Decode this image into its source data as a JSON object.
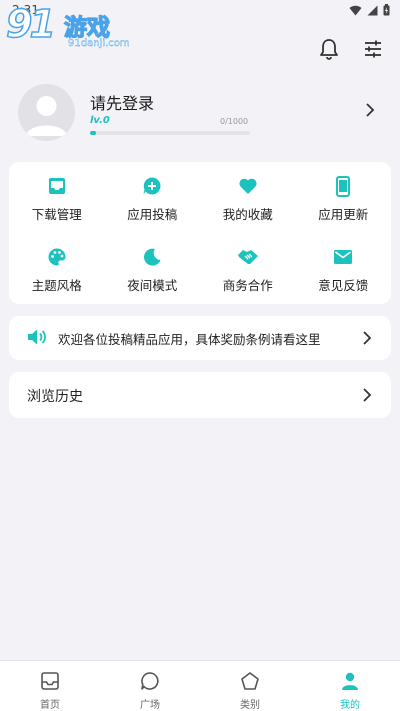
{
  "status_bar": {
    "time": "2:31"
  },
  "watermark": {
    "number": "91",
    "title": "游戏",
    "url": "91danji.com"
  },
  "header": {
    "notification_icon": "bell-icon",
    "settings_icon": "sliders-icon"
  },
  "profile": {
    "login_prompt": "请先登录",
    "level": "lv.0",
    "exp_text": "0/1000",
    "exp_progress": 0.04
  },
  "grid": {
    "items": [
      {
        "label": "下载管理",
        "icon": "inbox-icon"
      },
      {
        "label": "应用投稿",
        "icon": "chat-plus-icon"
      },
      {
        "label": "我的收藏",
        "icon": "heart-icon"
      },
      {
        "label": "应用更新",
        "icon": "phone-icon"
      },
      {
        "label": "主题风格",
        "icon": "palette-icon"
      },
      {
        "label": "夜间模式",
        "icon": "moon-icon"
      },
      {
        "label": "商务合作",
        "icon": "handshake-icon"
      },
      {
        "label": "意见反馈",
        "icon": "mail-icon"
      }
    ]
  },
  "notice": {
    "text": "欢迎各位投稿精品应用，具体奖励条例请看这里"
  },
  "history": {
    "label": "浏览历史"
  },
  "bottom_nav": {
    "items": [
      {
        "label": "首页",
        "icon": "home-inbox-icon"
      },
      {
        "label": "广场",
        "icon": "chat-bubble-icon"
      },
      {
        "label": "类别",
        "icon": "pentagon-icon"
      },
      {
        "label": "我的",
        "icon": "person-icon"
      }
    ],
    "active_index": 3
  },
  "colors": {
    "accent": "#1cc2bd",
    "background": "#f2f2f7",
    "card": "#ffffff"
  }
}
